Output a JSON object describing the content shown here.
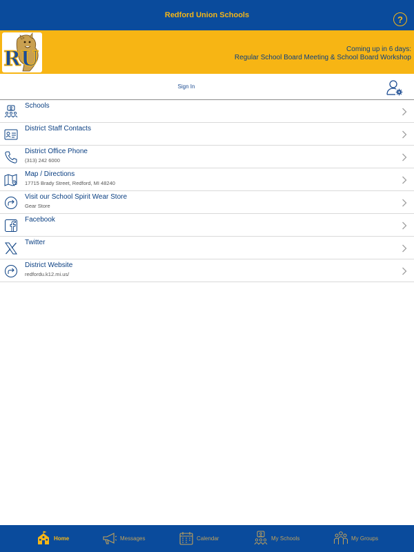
{
  "header": {
    "title": "Redford Union Schools",
    "help_icon": "question-circle-icon",
    "help_glyph": "?"
  },
  "banner": {
    "logo_text": "RU",
    "upcoming_line1": "Coming up in 6 days:",
    "upcoming_line2": "Regular School Board Meeting & School Board Workshop"
  },
  "signin": {
    "label": "Sign In",
    "icon": "user-gear-icon"
  },
  "items": [
    {
      "label": "Schools",
      "sub": "",
      "icon": "schools-icon"
    },
    {
      "label": "District Staff Contacts",
      "sub": "",
      "icon": "contact-card-icon"
    },
    {
      "label": "District Office Phone",
      "sub": "(313) 242 6000",
      "icon": "phone-icon"
    },
    {
      "label": "Map / Directions",
      "sub": "17715 Brady Street, Redford, MI 48240",
      "icon": "map-icon"
    },
    {
      "label": "Visit our School Spirit Wear Store",
      "sub": "Gear Store",
      "icon": "external-link-icon"
    },
    {
      "label": "Facebook",
      "sub": "",
      "icon": "facebook-icon"
    },
    {
      "label": "Twitter",
      "sub": "",
      "icon": "x-twitter-icon"
    },
    {
      "label": "District Website",
      "sub": "redfordu.k12.mi.us/",
      "icon": "external-link-icon"
    }
  ],
  "tabs": [
    {
      "label": "Home",
      "icon": "school-house-icon",
      "active": true
    },
    {
      "label": "Messages",
      "icon": "megaphone-icon",
      "active": false
    },
    {
      "label": "Calendar",
      "icon": "calendar-icon",
      "active": false
    },
    {
      "label": "My Schools",
      "icon": "schools-icon",
      "active": false
    },
    {
      "label": "My Groups",
      "icon": "groups-icon",
      "active": false
    }
  ],
  "colors": {
    "brand_blue": "#0a4b9c",
    "brand_gold": "#f7b514",
    "text_blue": "#0a3f82"
  }
}
